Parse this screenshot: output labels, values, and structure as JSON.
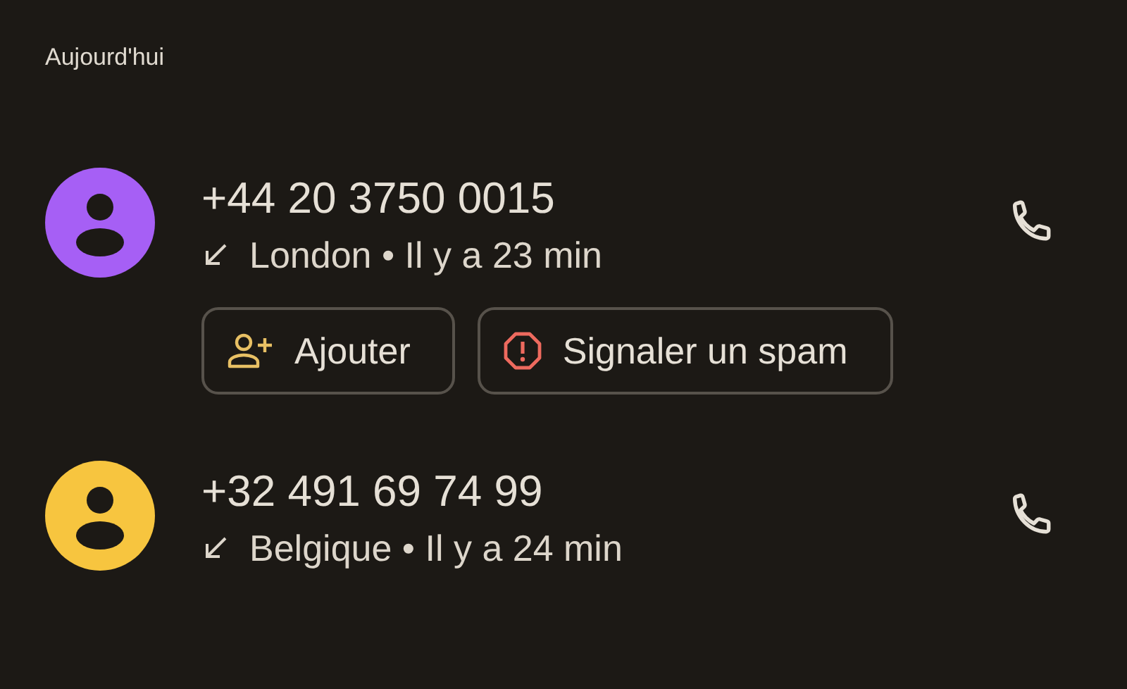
{
  "section_label": "Aujourd'hui",
  "calls": [
    {
      "number": "+44 20 3750 0015",
      "detail": "London • Il y a 23 min",
      "color": "#a65ff5",
      "actions": [
        {
          "kind": "add",
          "label": "Ajouter"
        },
        {
          "kind": "spam",
          "label": "Signaler un spam"
        }
      ]
    },
    {
      "number": "+32 491 69 74 99",
      "detail": "Belgique • Il y a 24 min",
      "color": "#f7c53f"
    }
  ]
}
